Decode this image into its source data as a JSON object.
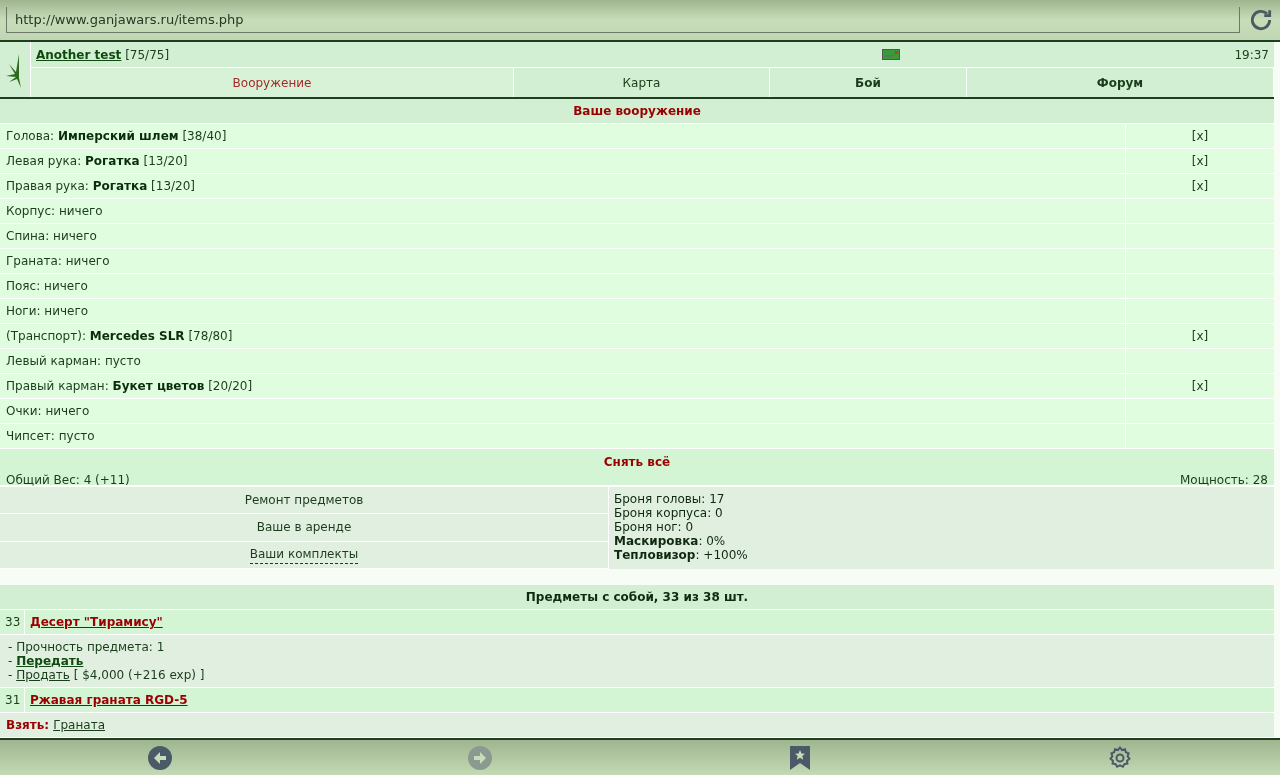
{
  "browser": {
    "url": "http://www.ganjawars.ru/items.php"
  },
  "header": {
    "player": "Another test",
    "hp": "[75/75]",
    "time": "19:37"
  },
  "nav": [
    {
      "label": "Вооружение",
      "selected": true,
      "bold": false
    },
    {
      "label": "Карта",
      "selected": false,
      "bold": false
    },
    {
      "label": "Бой",
      "selected": false,
      "bold": true
    },
    {
      "label": "Форум",
      "selected": false,
      "bold": true
    }
  ],
  "equipment": {
    "title": "Ваше вооружение",
    "rows": [
      {
        "slot": "Голова:",
        "item": "Имперский шлем",
        "condition": "[38/40]",
        "remove": "[x]"
      },
      {
        "slot": "Левая рука:",
        "item": "Рогатка",
        "condition": "[13/20]",
        "remove": "[x]"
      },
      {
        "slot": "Правая рука:",
        "item": "Рогатка",
        "condition": "[13/20]",
        "remove": "[x]"
      },
      {
        "slot": "Корпус:",
        "empty": "ничего"
      },
      {
        "slot": "Спина:",
        "empty": "ничего"
      },
      {
        "slot": "Граната:",
        "empty": "ничего"
      },
      {
        "slot": "Пояс:",
        "empty": "ничего"
      },
      {
        "slot": "Ноги:",
        "empty": "ничего"
      },
      {
        "slot": "(Транспорт):",
        "item": "Mercedes SLR",
        "condition": "[78/80]",
        "remove": "[x]"
      },
      {
        "slot": "Левый карман:",
        "empty": "пусто"
      },
      {
        "slot": "Правый карман:",
        "item": "Букет цветов",
        "condition": "[20/20]",
        "remove": "[x]"
      },
      {
        "slot": "Очки:",
        "empty": "ничего"
      },
      {
        "slot": "Чипсет:",
        "empty": "пусто"
      }
    ],
    "remove_all": "Снять всё",
    "weight": "Общий Вес: 4 (+11)",
    "power": "Мощность: 28"
  },
  "links": [
    {
      "label": "Ремонт предметов",
      "kind": "plain"
    },
    {
      "label": "Ваше в аренде",
      "kind": "plain"
    },
    {
      "label": "Ваши комплекты",
      "kind": "dashed"
    }
  ],
  "stats": [
    {
      "label": "Броня головы",
      "value": ": 17",
      "bold": false
    },
    {
      "label": "Броня корпуса",
      "value": ": 0",
      "bold": false
    },
    {
      "label": "Броня ног",
      "value": ": 0",
      "bold": false
    },
    {
      "label": "Маскировка",
      "value": ": 0%",
      "bold": true
    },
    {
      "label": "Тепловизор",
      "value": ": +100%",
      "bold": true
    }
  ],
  "inventory": {
    "title": "Предметы с собой, 33 из 38 шт.",
    "items": [
      {
        "count": "33",
        "name": "Десерт \"Тирамису\"",
        "details": [
          {
            "kind": "text",
            "text": "- Прочность предмета: 1"
          },
          {
            "kind": "bold_link",
            "prefix": "- ",
            "link": "Передать"
          },
          {
            "kind": "link",
            "prefix": "- ",
            "link": "Продать",
            "suffix": " [ $4,000 (+216 exp) ]"
          }
        ]
      },
      {
        "count": "31",
        "name": "Ржавая граната RGD-5",
        "details": [
          {
            "kind": "take",
            "prefix": "Взять:",
            "link": "Граната"
          }
        ]
      }
    ]
  }
}
